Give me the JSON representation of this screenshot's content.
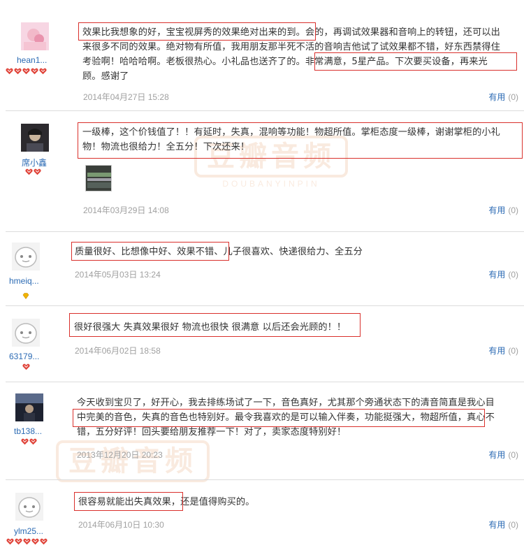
{
  "watermark": {
    "title": "豆瓣音频",
    "subtitle": "DOUBANYINPIN"
  },
  "colors": {
    "link": "#2c6bb4",
    "highlight": "#d9302c",
    "muted": "#a0a0a0",
    "badge": "#e0443a"
  },
  "reviews": [
    {
      "username": "hean1...",
      "avatar": "pink-baby-photo",
      "badges": 5,
      "badge_type": "heart",
      "lines": [
        "效果比我想象的好，宝宝视屏秀的效果绝对出来的到。会的，再调试效果器和音响上的转钮，还可以出",
        "来很多不同的效果。绝对物有所值，我用朋友那半死不活的音响吉他试了试效果都不错，好东西禁得住",
        "考验啊！哈哈哈啊。老板很热心。小礼品也送齐了的。非常满意，5星产品。下次要买设备，再来光",
        "顾。感谢了"
      ],
      "date": "2014年04月27日 15:28",
      "useful_label": "有用",
      "useful_count": "(0)"
    },
    {
      "username": "席小鑫",
      "avatar": "dark-portrait-photo",
      "badges": 2,
      "badge_type": "heart",
      "lines": [
        "一级棒，这个价钱值了！！有延时，失真，混响等功能！物超所值。掌柜态度一级棒，谢谢掌柜的小礼",
        "物！物流也很给力！全五分！下次还来！"
      ],
      "has_photo": true,
      "date": "2014年03月29日 14:08",
      "useful_label": "有用",
      "useful_count": "(0)"
    },
    {
      "username": "hmeiq...",
      "avatar": "default-face",
      "badges": 1,
      "badge_type": "gem",
      "lines": [
        "质量很好、比想像中好、效果不错、儿子很喜欢、快递很给力、全五分"
      ],
      "date": "2014年05月03日 13:24",
      "useful_label": "有用",
      "useful_count": "(0)"
    },
    {
      "username": "63179...",
      "avatar": "default-face",
      "badges": 1,
      "badge_type": "heart",
      "lines": [
        "很好很强大 失真效果很好 物流也很快 很满意 以后还会光顾的！！"
      ],
      "date": "2014年06月02日 18:58",
      "useful_label": "有用",
      "useful_count": "(0)"
    },
    {
      "username": "tb138...",
      "avatar": "dark-scene-photo",
      "badges": 2,
      "badge_type": "heart",
      "lines": [
        "今天收到宝贝了，好开心，我去排练场试了一下，音色真好，尤其那个旁通状态下的清音简直是我心目",
        "中完美的音色，失真的音色也特别好。最令我喜欢的是可以输入伴奏，功能挺强大，物超所值，真心不",
        "错，五分好评！回头要给朋友推荐一下！对了，卖家态度特别好！"
      ],
      "date": "2013年12月20日 20:23",
      "useful_label": "有用",
      "useful_count": "(0)"
    },
    {
      "username": "ylm25...",
      "avatar": "default-face",
      "badges": 5,
      "badge_type": "heart",
      "lines": [
        "很容易就能出失真效果，还是值得购买的。"
      ],
      "date": "2014年06月10日 10:30",
      "useful_label": "有用",
      "useful_count": "(0)"
    }
  ]
}
